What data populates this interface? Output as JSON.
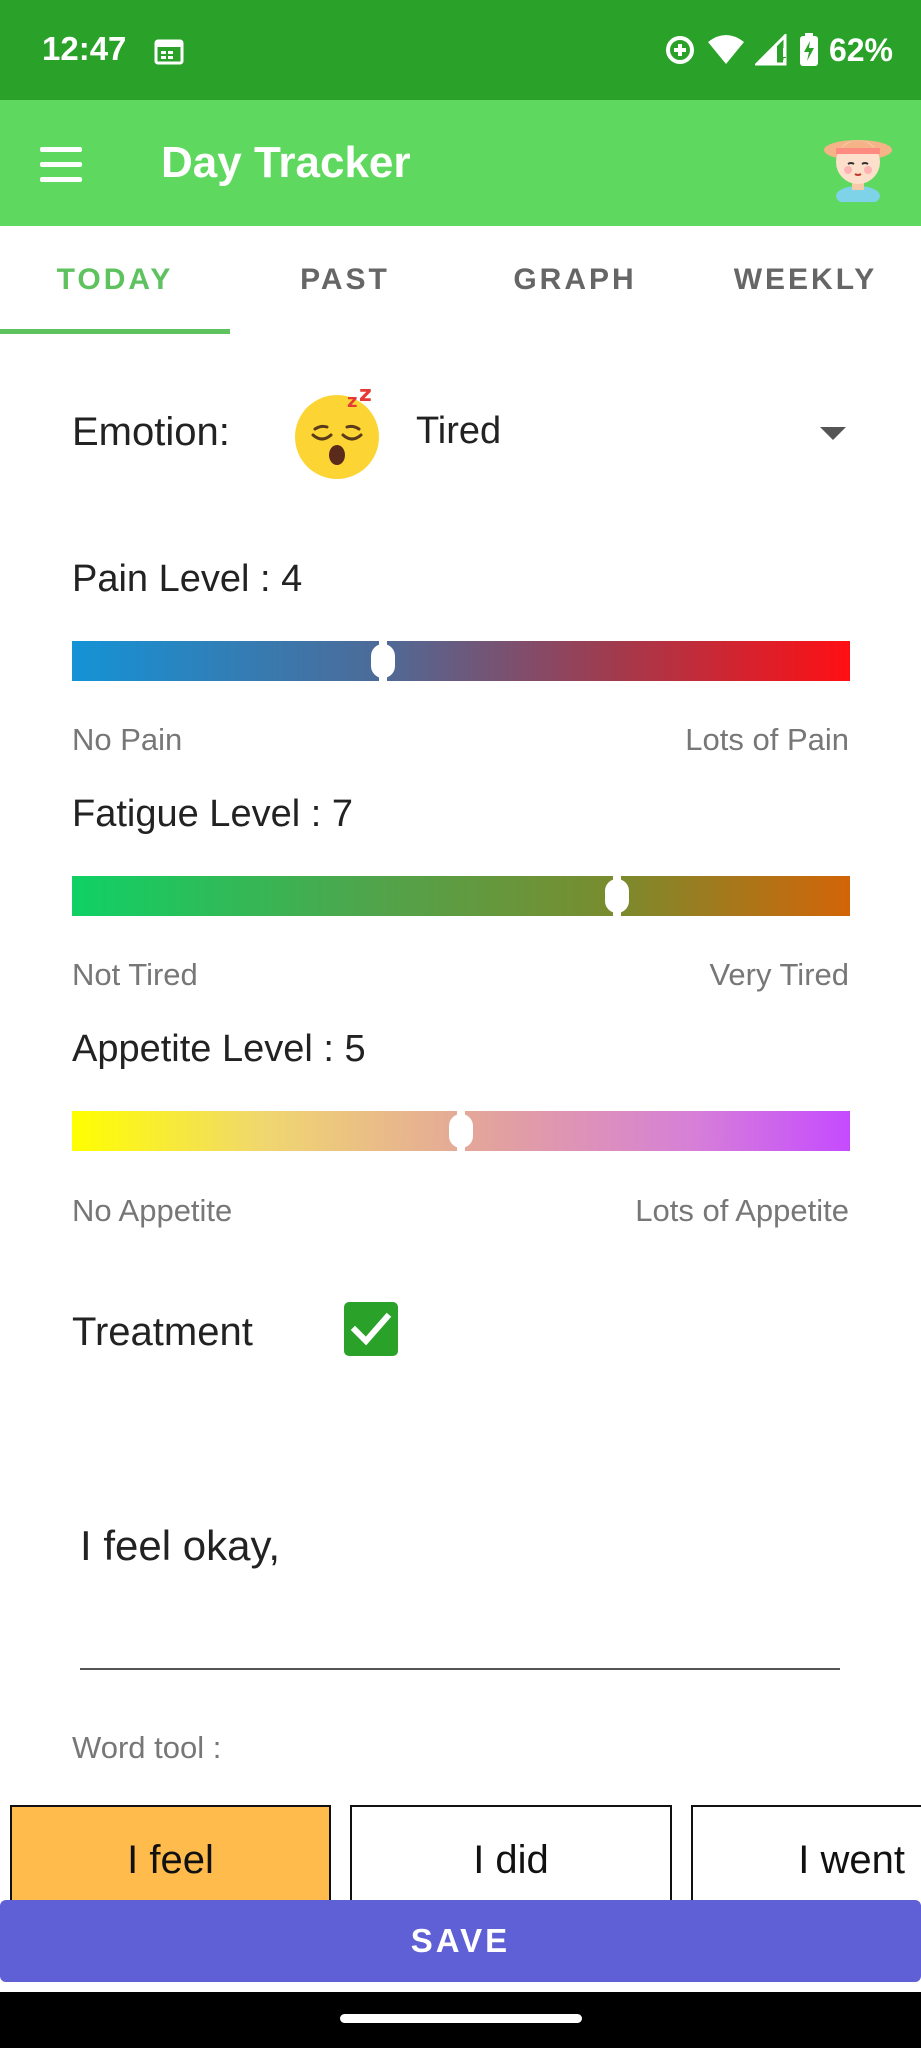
{
  "status_bar": {
    "time": "12:47",
    "battery_percent": "62%",
    "icons": [
      "calendar-icon",
      "data-saver-icon",
      "wifi-icon",
      "signal-icon",
      "battery-charging-icon"
    ]
  },
  "app_bar": {
    "title": "Day Tracker",
    "menu_icon": "menu-icon",
    "avatar_icon": "avatar-icon"
  },
  "tabs": [
    {
      "label": "TODAY",
      "active": true
    },
    {
      "label": "PAST",
      "active": false
    },
    {
      "label": "GRAPH",
      "active": false
    },
    {
      "label": "WEEKLY",
      "active": false
    }
  ],
  "emotion": {
    "label": "Emotion:",
    "value": "Tired",
    "emoji_icon": "sleeping-face-icon"
  },
  "sliders": [
    {
      "title": "Pain Level : 4",
      "value": 4,
      "max": 10,
      "min_label": "No Pain",
      "max_label": "Lots of Pain"
    },
    {
      "title": "Fatigue Level : 7",
      "value": 7,
      "max": 10,
      "min_label": "Not Tired",
      "max_label": "Very Tired"
    },
    {
      "title": "Appetite Level : 5",
      "value": 5,
      "max": 10,
      "min_label": "No Appetite",
      "max_label": "Lots of Appetite"
    }
  ],
  "treatment": {
    "label": "Treatment",
    "checked": true
  },
  "note": {
    "value": "I feel okay,"
  },
  "word_tool": {
    "label": "Word tool :",
    "buttons": [
      {
        "label": "I feel",
        "active": true
      },
      {
        "label": "I did",
        "active": false
      },
      {
        "label": "I went",
        "active": false
      }
    ]
  },
  "save_label": "SAVE",
  "colors": {
    "status_bar": "#2aa22a",
    "app_bar": "#5ed85e",
    "tab_active": "#5ec25e",
    "save_button": "#5f5fd6",
    "word_active": "#ffbc4c"
  }
}
